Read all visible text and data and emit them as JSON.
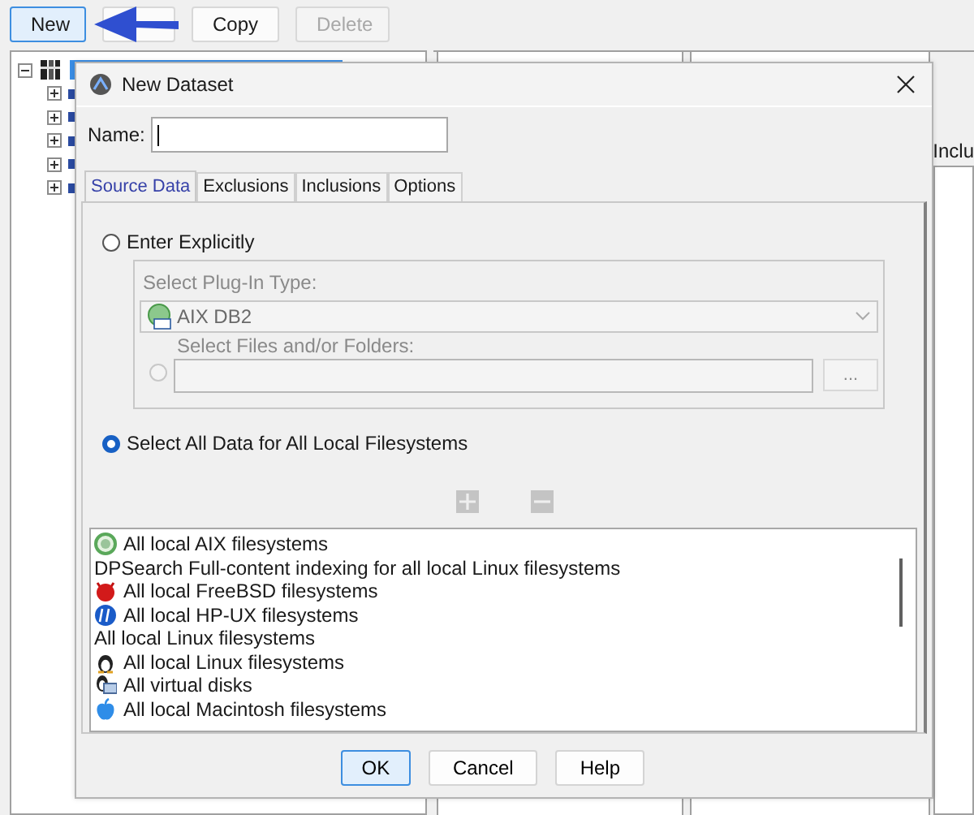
{
  "toolbar": [
    {
      "kind": "button",
      "label": "New",
      "disabled": false,
      "focused": true
    },
    {
      "kind": "covered"
    },
    {
      "kind": "button",
      "label": "Copy",
      "disabled": false,
      "focused": false
    },
    {
      "kind": "button",
      "label": "Delete",
      "disabled": true,
      "focused": false
    }
  ],
  "tree": [
    {
      "expanded": true,
      "selected": true,
      "children": [
        {
          "expanded": false
        },
        {
          "expanded": false
        },
        {
          "expanded": false
        },
        {
          "expanded": false
        },
        {
          "expanded": false
        }
      ]
    }
  ],
  "side_panel": {
    "label": "Inclu"
  },
  "dialog": {
    "title": "New Dataset",
    "name_field": {
      "label": "Name:"
    },
    "tabs": [
      {
        "label": "Source Data",
        "selected": true
      },
      {
        "label": "Exclusions",
        "selected": false
      },
      {
        "label": "Inclusions",
        "selected": false
      },
      {
        "label": "Options",
        "selected": false
      }
    ],
    "sources": [
      {
        "label": "Enter Explicitly",
        "selected": false
      },
      {
        "label": "Select All Data for All Local Filesystems",
        "selected": true
      }
    ],
    "plugin": {
      "label": "Select Plug-In Type:",
      "value": "AIX DB2",
      "disabled": true
    },
    "files": {
      "label": "Select Files and/or Folders:",
      "selected": false,
      "disabled": true,
      "browse": "..."
    },
    "list_tools": [
      {
        "kind": "add",
        "disabled": true
      },
      {
        "kind": "remove",
        "disabled": true
      }
    ],
    "filesystems": [
      {
        "label": "All local AIX filesystems",
        "kind": "aix"
      },
      {
        "label": "DPSearch Full-content indexing for all local Linux filesystems",
        "kind": "plain"
      },
      {
        "label": "All local FreeBSD filesystems",
        "kind": "freebsd"
      },
      {
        "label": "All local HP-UX filesystems",
        "kind": "hp"
      },
      {
        "label": "All local Linux filesystems",
        "kind": "plain"
      },
      {
        "label": "All local Linux filesystems",
        "kind": "linux"
      },
      {
        "label": "All virtual disks",
        "kind": "virtual"
      },
      {
        "label": "All local Macintosh filesystems",
        "kind": "mac"
      }
    ],
    "buttons": [
      {
        "label": "OK",
        "default": true
      },
      {
        "label": "Cancel",
        "default": false
      },
      {
        "label": "Help",
        "default": false
      }
    ]
  }
}
